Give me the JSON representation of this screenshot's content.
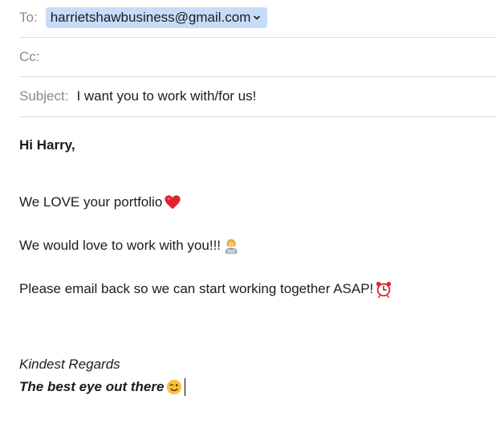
{
  "header": {
    "to_label": "To:",
    "to_recipient": "harrietshawbusiness@gmail.com",
    "cc_label": "Cc:",
    "cc_value": "",
    "subject_label": "Subject:",
    "subject_value": "I want you to work with/for us!"
  },
  "body": {
    "greeting": "Hi Harry,",
    "line1": "We LOVE your portfolio",
    "line1_emoji": "heart-emoji",
    "line2": "We would love to work with you!!! ",
    "line2_emoji": "person-at-laptop-emoji",
    "line3": "Please email back so we can start working together ASAP! ",
    "line3_emoji": "alarm-clock-emoji",
    "signoff": "Kindest Regards",
    "signature": "The best eye out there ",
    "signature_emoji": "winking-face-emoji"
  },
  "colors": {
    "token_bg": "#c6dcf9",
    "label_gray": "#8a8a8e",
    "divider": "#dcdcdc",
    "heart_red": "#e0242e"
  }
}
